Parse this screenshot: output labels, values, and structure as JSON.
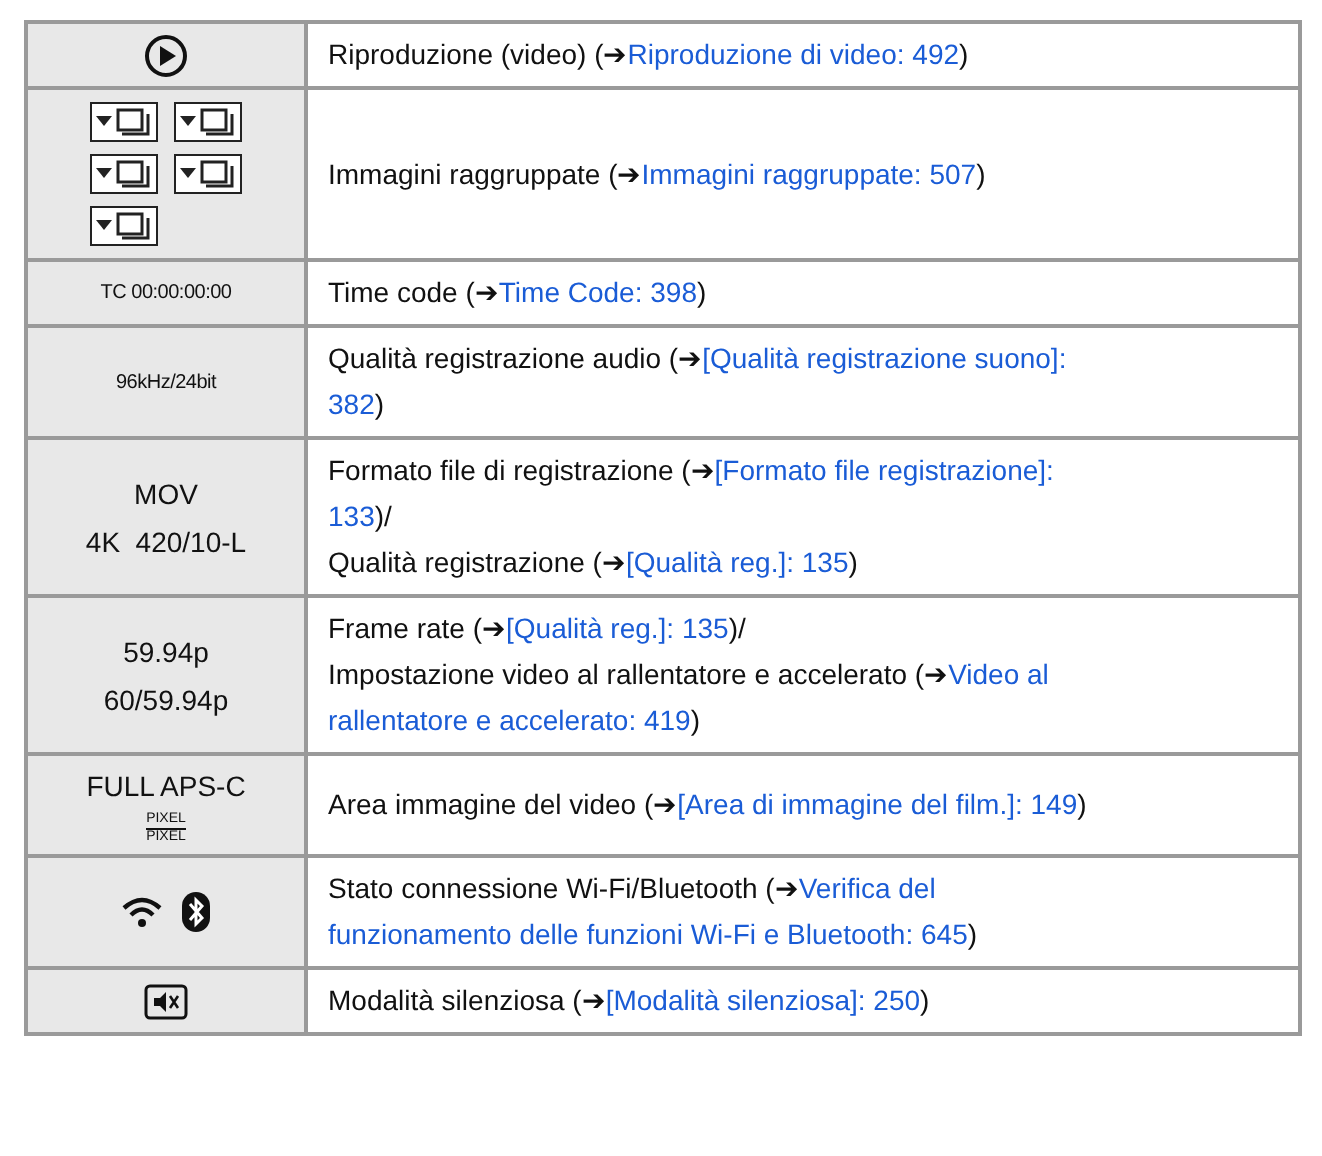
{
  "rows": [
    {
      "left": [
        {
          "kind": "play_icon"
        }
      ],
      "lines": [
        [
          {
            "kind": "text",
            "text": "Riproduzione (video) (➔"
          },
          {
            "kind": "link",
            "text": "Riproduzione di video: 492"
          },
          {
            "kind": "text",
            "text": ")"
          }
        ]
      ]
    },
    {
      "left": [
        {
          "kind": "group_icons"
        }
      ],
      "lines": [
        [
          {
            "kind": "text",
            "text": "Immagini raggruppate (➔"
          },
          {
            "kind": "link",
            "text": "Immagini raggruppate: 507"
          },
          {
            "kind": "text",
            "text": ")"
          }
        ]
      ]
    },
    {
      "left": [
        {
          "kind": "small_text",
          "text": "TC 00:00:00:00"
        }
      ],
      "lines": [
        [
          {
            "kind": "text",
            "text": "Time code (➔"
          },
          {
            "kind": "link",
            "text": "Time Code: 398"
          },
          {
            "kind": "text",
            "text": ")"
          }
        ]
      ]
    },
    {
      "left": [
        {
          "kind": "small_text",
          "text": "96kHz/24bit"
        }
      ],
      "lines": [
        [
          {
            "kind": "text",
            "text": "Qualità registrazione audio (➔"
          },
          {
            "kind": "link",
            "text": "[Qualità registrazione suono]:"
          }
        ],
        [
          {
            "kind": "link",
            "text": "382"
          },
          {
            "kind": "text",
            "text": ")"
          }
        ]
      ]
    },
    {
      "left": [
        {
          "kind": "text",
          "text": "MOV"
        },
        {
          "kind": "text",
          "text": "4K  420/10-L"
        }
      ],
      "lines": [
        [
          {
            "kind": "text",
            "text": "Formato file di registrazione (➔"
          },
          {
            "kind": "link",
            "text": "[Formato file registrazione]:"
          }
        ],
        [
          {
            "kind": "link",
            "text": "133"
          },
          {
            "kind": "text",
            "text": ")/"
          }
        ],
        [
          {
            "kind": "text",
            "text": "Qualità registrazione (➔"
          },
          {
            "kind": "link",
            "text": "[Qualità reg.]: 135"
          },
          {
            "kind": "text",
            "text": ")"
          }
        ]
      ]
    },
    {
      "left": [
        {
          "kind": "text",
          "text": "59.94p"
        },
        {
          "kind": "text",
          "text": "60/59.94p"
        }
      ],
      "lines": [
        [
          {
            "kind": "text",
            "text": "Frame rate (➔"
          },
          {
            "kind": "link",
            "text": "[Qualità reg.]: 135"
          },
          {
            "kind": "text",
            "text": ")/"
          }
        ],
        [
          {
            "kind": "text",
            "text": "Impostazione video al rallentatore e accelerato (➔"
          },
          {
            "kind": "link",
            "text": "Video al"
          }
        ],
        [
          {
            "kind": "link",
            "text": "rallentatore e accelerato: 419"
          },
          {
            "kind": "text",
            "text": ")"
          }
        ]
      ]
    },
    {
      "left": [
        {
          "kind": "text",
          "text": "FULL APS-C"
        },
        {
          "kind": "fraction",
          "top": "PIXEL",
          "bottom": "PIXEL"
        }
      ],
      "lines": [
        [
          {
            "kind": "text",
            "text": "Area immagine del video (➔"
          },
          {
            "kind": "link",
            "text": "[Area di immagine del film.]: 149"
          },
          {
            "kind": "text",
            "text": ")"
          }
        ]
      ]
    },
    {
      "left": [
        {
          "kind": "wireless_icons"
        }
      ],
      "lines": [
        [
          {
            "kind": "text",
            "text": "Stato connessione Wi-Fi/Bluetooth (➔"
          },
          {
            "kind": "link",
            "text": "Verifica del"
          }
        ],
        [
          {
            "kind": "link",
            "text": "funzionamento delle funzioni Wi-Fi e Bluetooth: 645"
          },
          {
            "kind": "text",
            "text": ")"
          }
        ]
      ]
    },
    {
      "left": [
        {
          "kind": "silent_icon"
        }
      ],
      "lines": [
        [
          {
            "kind": "text",
            "text": "Modalità silenziosa (➔"
          },
          {
            "kind": "link",
            "text": "[Modalità silenziosa]: 250"
          },
          {
            "kind": "text",
            "text": ")"
          }
        ]
      ]
    }
  ]
}
